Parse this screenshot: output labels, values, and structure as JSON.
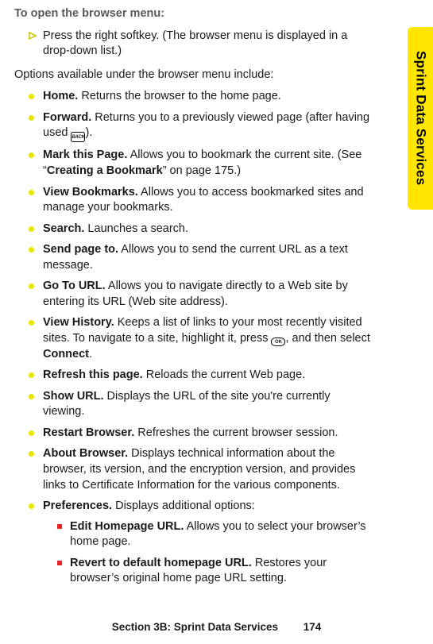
{
  "heading": "To open the browser menu:",
  "step": "Press the right softkey. (The browser menu is displayed in a drop-down list.)",
  "intro": "Options available under the browser menu include:",
  "backKeyLabel": "BACK",
  "okKeyLabel": "OK",
  "items": [
    {
      "name": "Home.",
      "desc": " Returns the browser to the home page."
    },
    {
      "name": "Forward.",
      "desc_a": " Returns you to a previously viewed page (after having used ",
      "desc_b": ")."
    },
    {
      "name": "Mark this Page.",
      "desc_a": " Allows you to bookmark the current site. (See “",
      "link": "Creating a Bookmark",
      "desc_b": "” on page 175.)"
    },
    {
      "name": "View Bookmarks.",
      "desc": " Allows you to access bookmarked sites and manage your bookmarks."
    },
    {
      "name": "Search.",
      "desc": " Launches a search."
    },
    {
      "name": "Send page to.",
      "desc": " Allows you to send the current URL as a text message."
    },
    {
      "name": "Go To URL.",
      "desc": " Allows you to navigate directly to a Web site by entering its URL (Web site address)."
    },
    {
      "name": "View History.",
      "desc_a": " Keeps a list of links to your most recently visited sites. To navigate to a site, highlight it, press ",
      "desc_b": ", and then select ",
      "connect": "Connect",
      "desc_c": "."
    },
    {
      "name": "Refresh this page.",
      "desc": " Reloads the current Web page."
    },
    {
      "name": "Show URL.",
      "desc": " Displays the URL of the site you're currently viewing."
    },
    {
      "name": "Restart Browser.",
      "desc": " Refreshes the current browser session."
    },
    {
      "name": "About Browser.",
      "desc": " Displays technical information about the browser, its version, and the encryption version, and provides links to Certificate Information for the various components."
    },
    {
      "name": "Preferences.",
      "desc": " Displays additional options:",
      "sub": [
        {
          "name": "Edit Homepage URL.",
          "desc": " Allows you to select your browser’s home page."
        },
        {
          "name": "Revert to default homepage URL.",
          "desc": " Restores your browser’s original home page URL setting."
        }
      ]
    }
  ],
  "sideTab": "Sprint Data Services",
  "footer": {
    "section": "Section 3B: Sprint Data Services",
    "page": "174"
  }
}
